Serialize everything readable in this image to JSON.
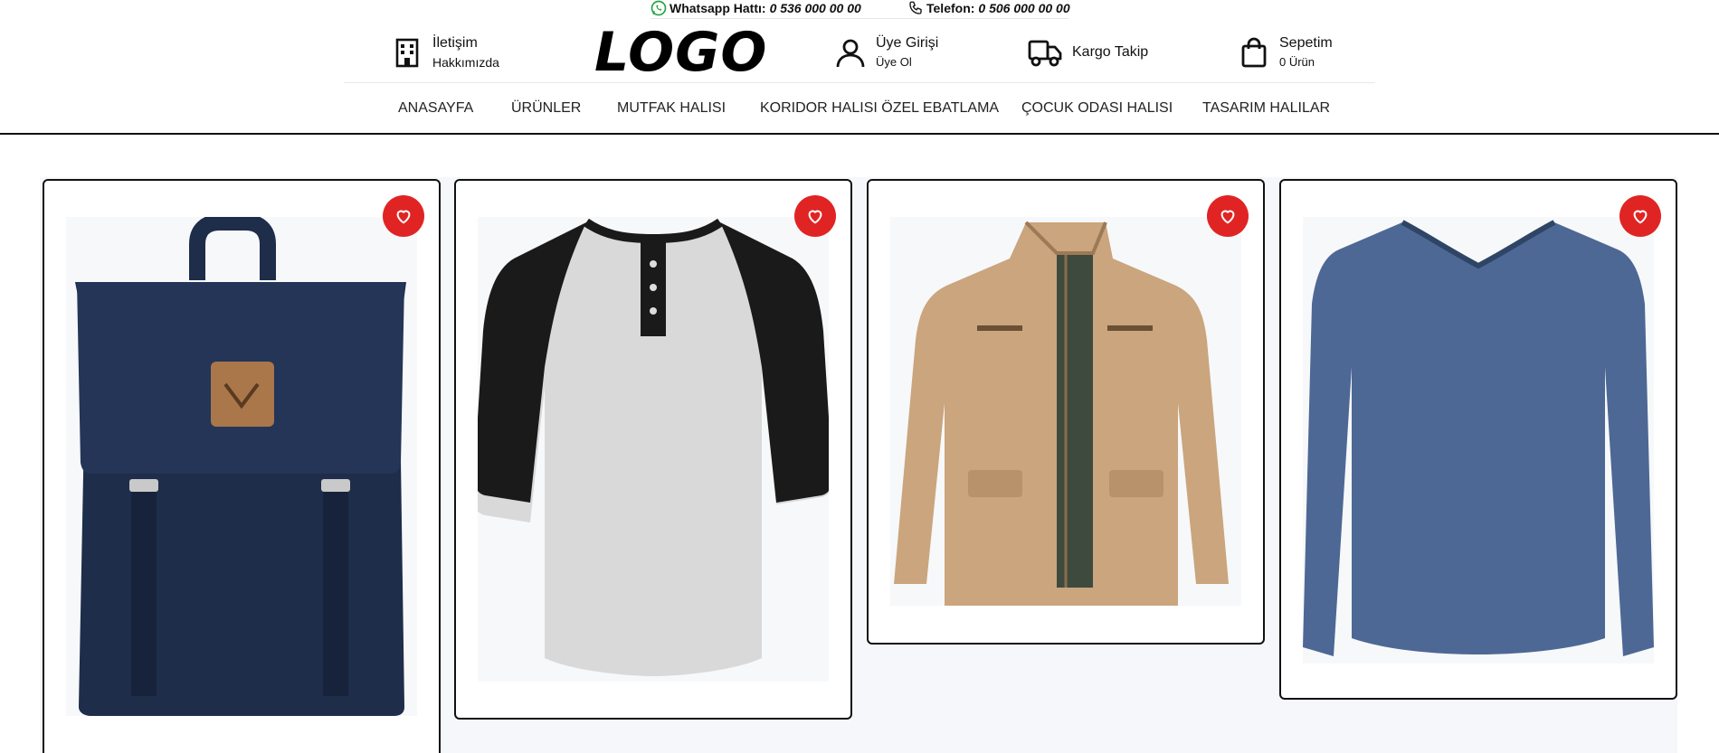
{
  "topbar": {
    "whatsapp_label": "Whatsapp Hattı:",
    "whatsapp_number": "0 536 000 00 00",
    "phone_label": "Telefon:",
    "phone_number": "0 506 000 00 00",
    "whatsapp_icon": "whatsapp-icon",
    "phone_icon": "phone-icon"
  },
  "header": {
    "contact_link": "İletişim",
    "about_link": "Hakkımızda",
    "logo_text": "LOGO",
    "login_label": "Üye Girişi",
    "register_label": "Üye Ol",
    "cargo_label": "Kargo Takip",
    "cart_label": "Sepetim",
    "cart_count": "0 Ürün",
    "icons": {
      "contact": "building-icon",
      "user": "user-icon",
      "cargo": "truck-icon",
      "cart": "shopping-bag-icon"
    }
  },
  "nav": {
    "items": [
      "ANASAYFA",
      "ÜRÜNLER",
      "MUTFAK HALISI",
      "KORIDOR HALISI ÖZEL EBATLAMA",
      "ÇOCUK ODASI HALISI",
      "TASARIM HALILAR"
    ]
  },
  "products": [
    {
      "kind": "backpack",
      "color": "#1e2d4a"
    },
    {
      "kind": "raglan-tshirt",
      "color": "#d6d6d6"
    },
    {
      "kind": "jacket",
      "color": "#caa57d"
    },
    {
      "kind": "longsleeve",
      "color": "#4d6894"
    }
  ],
  "colors": {
    "favorite": "#e02424",
    "border": "#111111",
    "grid_bg": "#f5f7fa"
  }
}
